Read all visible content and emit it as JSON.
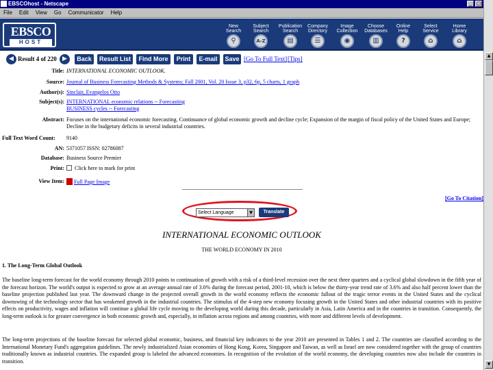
{
  "window": {
    "title": "EBSCOhost - Netscape",
    "controls": [
      "_",
      "□",
      "×"
    ]
  },
  "menu": [
    "File",
    "Edit",
    "View",
    "Go",
    "Communicator",
    "Help"
  ],
  "header": {
    "logo_top": "EBSCO",
    "logo_bottom": "HOST",
    "nav": [
      {
        "label": "New\nSearch",
        "icon": "magnifier-icon",
        "glyph": "🔍"
      },
      {
        "label": "Subject\nSearch",
        "icon": "a-z-icon",
        "glyph": "A-Z"
      },
      {
        "label": "Publication\nSearch",
        "icon": "book-icon",
        "glyph": "▤"
      },
      {
        "label": "Company\nDirectory",
        "icon": "directory-icon",
        "glyph": "☰"
      },
      {
        "label": "Image\nCollection",
        "icon": "image-icon",
        "glyph": "◉"
      },
      {
        "label": "Choose\nDatabases",
        "icon": "databases-icon",
        "glyph": "▥"
      },
      {
        "label": "Online\nHelp",
        "icon": "help-icon",
        "glyph": "?"
      },
      {
        "label": "Select\nService",
        "icon": "service-icon",
        "glyph": "⌂"
      },
      {
        "label": "Home\nLibrary",
        "icon": "library-icon",
        "glyph": "⌂"
      }
    ]
  },
  "toolbar": {
    "result": "Result 4 of 220",
    "buttons": [
      "Back",
      "Result List",
      "Find More",
      "Print",
      "E-mail",
      "Save"
    ],
    "links": [
      "[Go To Full Text]",
      "[Tips]"
    ]
  },
  "record": {
    "title_label": "Title:",
    "title": "INTERNATIONAL ECONOMIC OUTLOOK.",
    "source_label": "Source:",
    "source": "Journal of Business Forecasting Methods & Systems; Fall 2001, Vol. 20 Issue 3, p32, 6p, 5 charts, 1 graph",
    "author_label": "Author(s):",
    "author": "Sinclair, Evangelos Otto",
    "subject_label": "Subject(s):",
    "subject_1": "INTERNATIONAL economic relations -- Forecasting",
    "subject_2": "BUSINESS cycles -- Forecasting",
    "abstract_label": "Abstract:",
    "abstract": "Focuses on the international economic forecasting. Continuance of global economic growth and decline cycle; Expansion of the margin of fiscal policy of the United States and Europe; Decline in the budgetary deficits in several industrial countries.",
    "wordcount_label": "Full Text Word Count:",
    "wordcount": "9140",
    "an_label": "AN:",
    "an": "5371057 ISSN: 02786087",
    "database_label": "Database:",
    "database": "Business Source Premier",
    "print_label": "Print:",
    "print": "Click here to mark for print",
    "view_label": "View Item:",
    "view": "Full Page Image"
  },
  "citation_link": "[Go To Citation]",
  "translate": {
    "select": "Select Language",
    "button": "Translate"
  },
  "article": {
    "title": "INTERNATIONAL ECONOMIC OUTLOOK",
    "subtitle": "THE WORLD ECONOMY IN 2010",
    "section": "1. The Long-Term Global Outlook",
    "para1": "The baseline long-term forecast for the world economy through 2010 points to continuation of growth with a risk of a third-level recession over the next three quarters and a cyclical global slowdown in the fifth year of the forecast horizon. The world's output is expected to grow at an average annual rate of 3.0% during the forecast period, 2001-10, which is below the thirty-year trend rate of 3.6% and also half percent lower than the baseline projection published last year. The downward change in the projected overall growth in the world economy reflects the economic fallout of the tragic terror events in the United States and the cyclical downswing of the technology sector that has weakened growth in the industrial countries. The stimulus of the 4-step new economy focusing growth in the United States and other industrial countries with its positive effects on productivity, wages and inflation will continue a global life cycle moving to the developing world during this decade, particularly in Asia, Latin America and in the countries in transition. Consequently, the long-term outlook is for greater convergence in both economic growth and, especially, in inflation across regions and among countries, with more and different levels of development.",
    "para2": "The long-term projections of the baseline forecast for selected global economic, business, and financial key indicators to the year 2010 are presented in Tables 1 and 2. The countries are classified according to the International Monetary Fund's aggregation guidelines. The newly industrialized Asian economies of Hong Kong, Korea, Singapore and Taiwan, as well as Israel are now considered together with the group of countries traditionally known as industrial countries. The expanded group is labeled the advanced economies. In recognition of the evolution of the world economy, the developing countries now also include the countries in transition."
  }
}
